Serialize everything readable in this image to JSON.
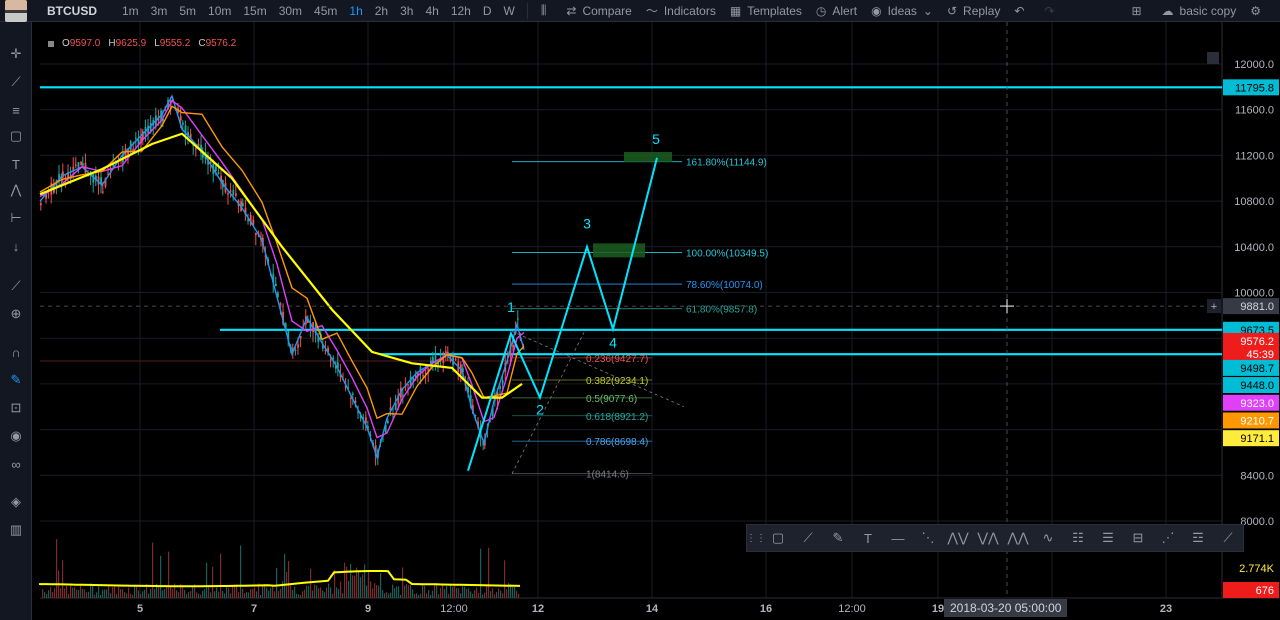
{
  "toolbar": {
    "symbol": "BTCUSD",
    "intervals": [
      "1m",
      "3m",
      "5m",
      "10m",
      "15m",
      "30m",
      "45m",
      "1h",
      "2h",
      "3h",
      "4h",
      "12h",
      "D",
      "W"
    ],
    "active_interval": "1h",
    "compare": "Compare",
    "indicators": "Indicators",
    "templates": "Templates",
    "alert": "Alert",
    "ideas": "Ideas",
    "replay": "Replay",
    "layout": "basic copy"
  },
  "legend": {
    "o_key": "O",
    "o_val": "9597.0",
    "h_key": "H",
    "h_val": "9625.9",
    "l_key": "L",
    "l_val": "9555.2",
    "c_key": "C",
    "c_val": "9576.2"
  },
  "price_axis": {
    "range": [
      8000,
      12000
    ],
    "ticks": [
      "12000.0",
      "11600.0",
      "11200.0",
      "10800.0",
      "10400.0",
      "10000.0",
      "8400.0",
      "8000.0"
    ],
    "volume_labels": [
      {
        "text": "2.774K",
        "color": "#ffeb3b"
      },
      {
        "text": "676",
        "color": "#ef5350"
      }
    ],
    "badges": [
      {
        "text": "11795.8",
        "price": 11795.8,
        "bg": "#00bcd4",
        "fg": "#000000"
      },
      {
        "text": "9881.0",
        "price": 9881.0,
        "bg": "#363a45",
        "fg": "#d1d4dc"
      },
      {
        "text": "9673.5",
        "price": 9673.5,
        "bg": "#00bcd4",
        "fg": "#000000"
      },
      {
        "text": "9576.2",
        "price": 9576.2,
        "bg": "#ef1c1c",
        "fg": "#ffffff"
      },
      {
        "text": "45:39",
        "price": 9460,
        "bg": "#ef1c1c",
        "fg": "#ffffff"
      },
      {
        "text": "9498.7",
        "price": 9340,
        "bg": "#00bcd4",
        "fg": "#000000"
      },
      {
        "text": "9448.0",
        "price": 9190,
        "bg": "#00bcd4",
        "fg": "#000000"
      },
      {
        "text": "9323.0",
        "price": 9035,
        "bg": "#e040fb",
        "fg": "#ffffff"
      },
      {
        "text": "9210.7",
        "price": 8880,
        "bg": "#ff9800",
        "fg": "#ffffff"
      },
      {
        "text": "9171.1",
        "price": 8725,
        "bg": "#ffeb3b",
        "fg": "#000000"
      }
    ]
  },
  "time_axis": [
    {
      "text": "5",
      "bold": true
    },
    {
      "text": "7",
      "bold": true
    },
    {
      "text": "9",
      "bold": true
    },
    {
      "text": "12:00",
      "bold": false
    },
    {
      "text": "12",
      "bold": true
    },
    {
      "text": "14",
      "bold": true
    },
    {
      "text": "16",
      "bold": true
    },
    {
      "text": "12:00",
      "bold": false
    },
    {
      "text": "19",
      "bold": true
    },
    {
      "text": "23",
      "bold": true
    }
  ],
  "crosshair_date": "2018-03-20 05:00:00",
  "horizontal_levels": [
    11795.8,
    9673.5,
    9576.2
  ],
  "fib_extension": [
    {
      "label": "161.80%(11144.9)",
      "price": 11144.9,
      "color": "#26c6da"
    },
    {
      "label": "100.00%(10349.5)",
      "price": 10349.5,
      "color": "#26c6da"
    },
    {
      "label": "78.60%(10074.0)",
      "price": 10074.0,
      "color": "#2196f3"
    },
    {
      "label": "61.80%(9857.8)",
      "price": 9857.8,
      "color": "#26a69a"
    }
  ],
  "fib_retracement": [
    {
      "label": "0.236(9427.7)",
      "price": 9427.7,
      "color": "#ef5350"
    },
    {
      "label": "0.382(9234.1)",
      "price": 9234.1,
      "color": "#c0ca33"
    },
    {
      "label": "0.5(9077.6)",
      "price": 9077.6,
      "color": "#66bb6a"
    },
    {
      "label": "0.618(8921.2)",
      "price": 8921.2,
      "color": "#26a69a"
    },
    {
      "label": "0.786(8698.4)",
      "price": 8698.4,
      "color": "#42a5f5"
    },
    {
      "label": "1(8414.6)",
      "price": 8414.6,
      "color": "#787b86"
    }
  ],
  "wave_labels": [
    "1",
    "2",
    "3",
    "4",
    "5"
  ],
  "drawing_tools": [
    "grip-icon",
    "rectangle-icon",
    "trend-line-icon",
    "brush-icon",
    "text-icon",
    "horizontal-line-icon",
    "fib-icon",
    "pattern-xabcd-icon",
    "pattern-abcd-icon",
    "pattern-3drives-icon",
    "elliott-wave-icon",
    "fib-retracement-icon",
    "fib-extension-icon",
    "long-position-icon",
    "forecast-icon",
    "regression-icon",
    "fib-fan-icon"
  ],
  "colors": {
    "background": "#000000",
    "cyan": "#00e5ff",
    "yellow": "#ffff00",
    "bull": "#26a69a",
    "bear": "#ef5350"
  }
}
